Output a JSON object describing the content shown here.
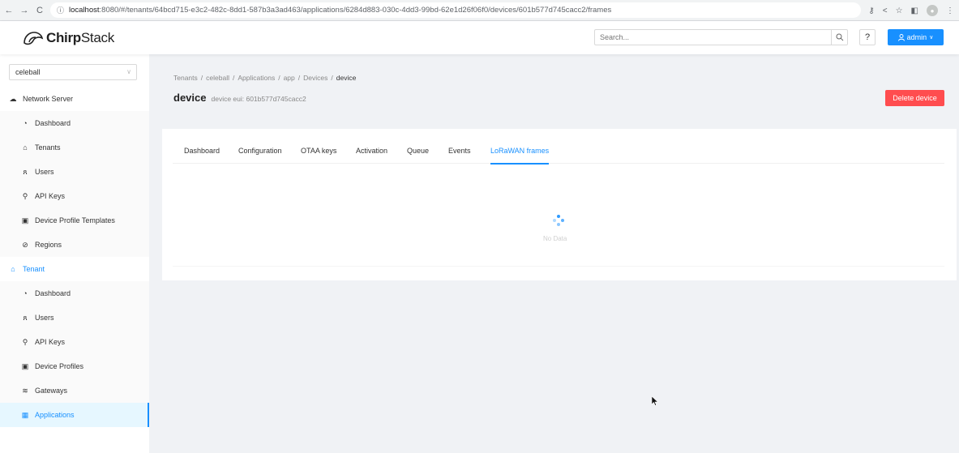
{
  "browser": {
    "url_host": "localhost",
    "url_rest": ":8080/#/tenants/64bcd715-e3c2-482c-8dd1-587b3a3ad463/applications/6284d883-030c-4dd3-99bd-62e1d26f06f0/devices/601b577d745cacc2/frames"
  },
  "header": {
    "logo_bold": "Chirp",
    "logo_light": "Stack",
    "search_placeholder": "Search...",
    "help_label": "?",
    "user_label": "admin"
  },
  "sidebar": {
    "tenant_value": "celeball",
    "network_server_label": "Network Server",
    "network_items": [
      {
        "label": "Dashboard",
        "icon": "dashboard-icon"
      },
      {
        "label": "Tenants",
        "icon": "home-icon"
      },
      {
        "label": "Users",
        "icon": "user-icon"
      },
      {
        "label": "API Keys",
        "icon": "key-icon"
      },
      {
        "label": "Device Profile Templates",
        "icon": "template-icon"
      },
      {
        "label": "Regions",
        "icon": "compass-icon"
      }
    ],
    "tenant_label": "Tenant",
    "tenant_items": [
      {
        "label": "Dashboard",
        "icon": "dashboard-icon"
      },
      {
        "label": "Users",
        "icon": "user-icon"
      },
      {
        "label": "API Keys",
        "icon": "key-icon"
      },
      {
        "label": "Device Profiles",
        "icon": "template-icon"
      },
      {
        "label": "Gateways",
        "icon": "wifi-icon"
      },
      {
        "label": "Applications",
        "icon": "appstore-icon"
      }
    ]
  },
  "breadcrumb": {
    "items": [
      "Tenants",
      "celeball",
      "Applications",
      "app",
      "Devices",
      "device"
    ],
    "separator": "/"
  },
  "page": {
    "title": "device",
    "subtitle": "device eui: 601b577d745cacc2",
    "delete_label": "Delete device"
  },
  "tabs": [
    {
      "label": "Dashboard"
    },
    {
      "label": "Configuration"
    },
    {
      "label": "OTAA keys"
    },
    {
      "label": "Activation"
    },
    {
      "label": "Queue"
    },
    {
      "label": "Events"
    },
    {
      "label": "LoRaWAN frames"
    }
  ],
  "content": {
    "empty_text": "No Data"
  },
  "colors": {
    "primary": "#1890ff",
    "danger": "#ff4d4f",
    "bg": "#f0f2f5"
  }
}
